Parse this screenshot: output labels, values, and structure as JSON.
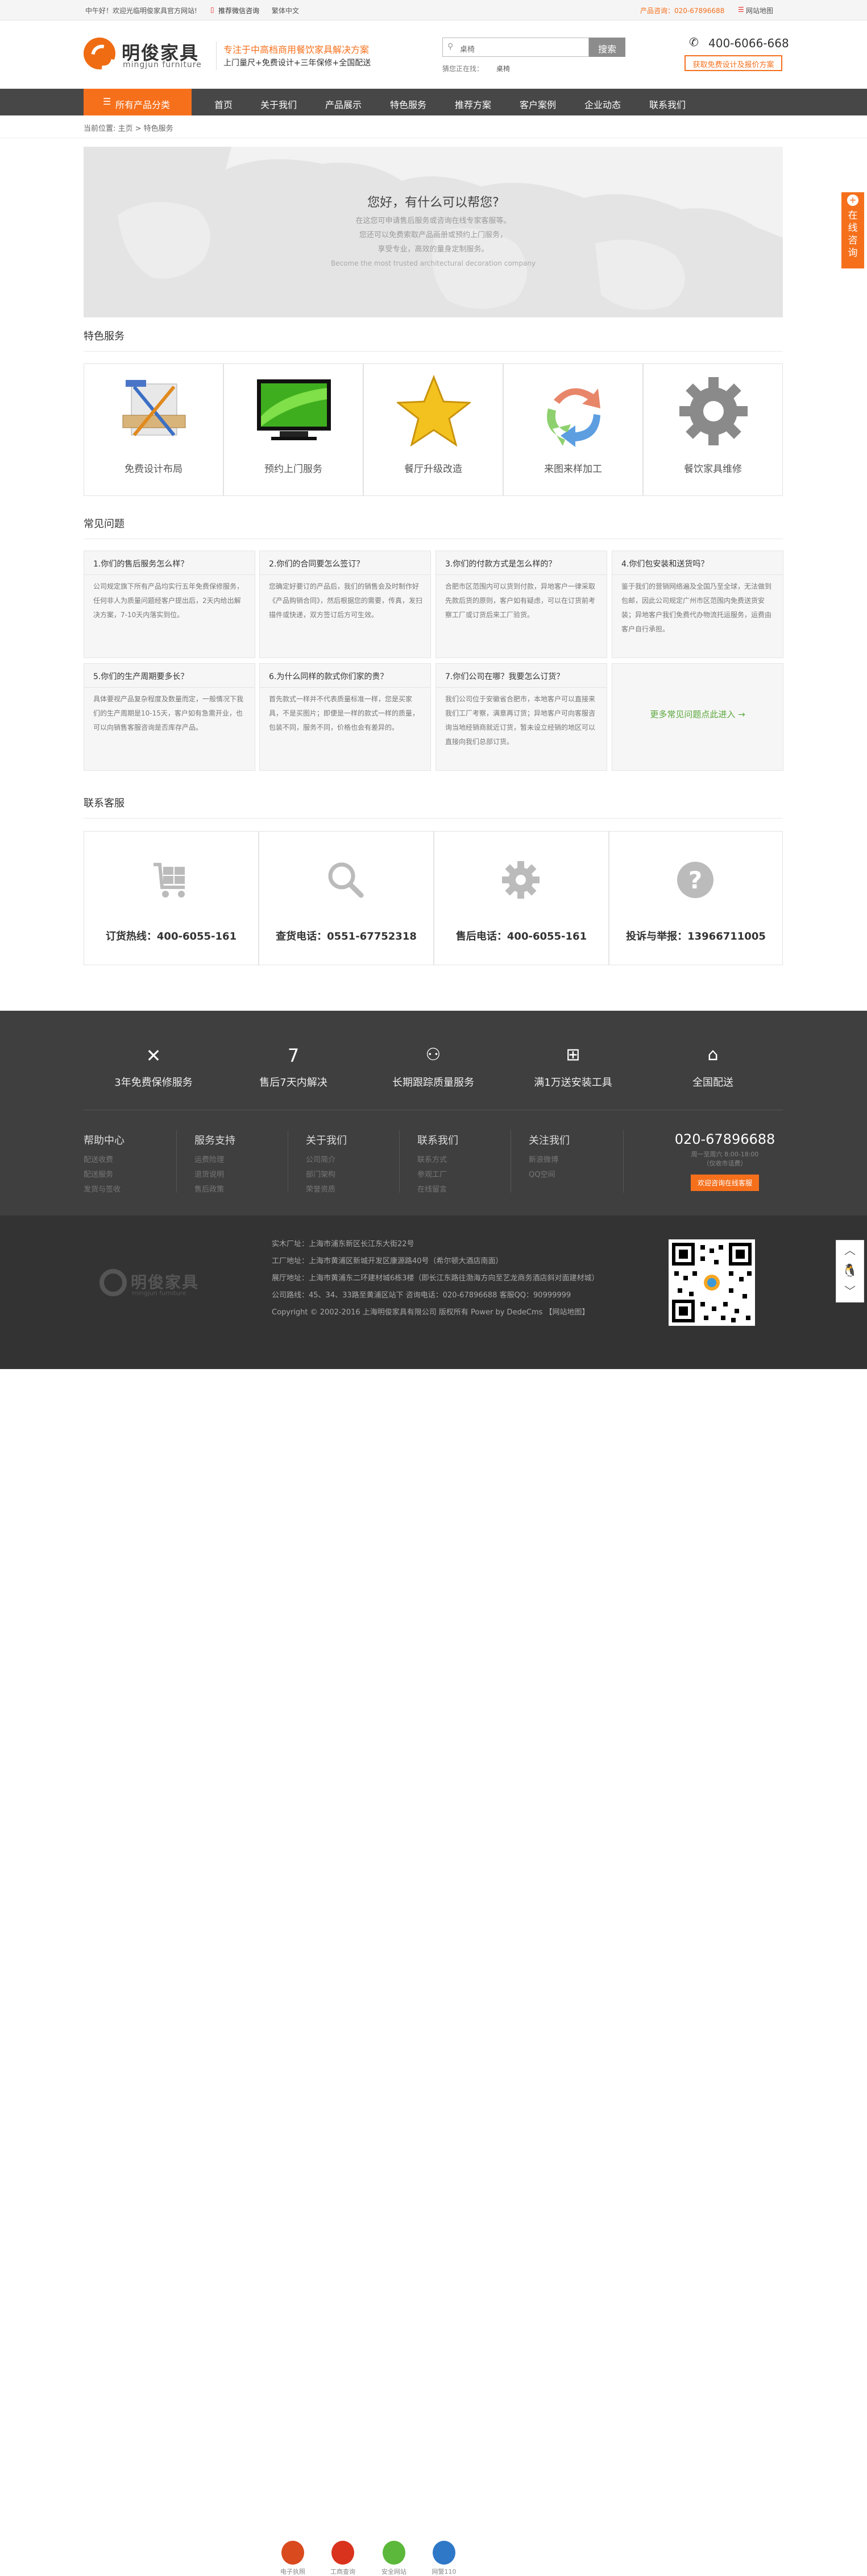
{
  "topbar": {
    "welcome": "中午好！欢迎光临明俊家具官方网站!",
    "wechat": "推荐微信咨询",
    "traditional": "繁体中文",
    "product_phone": "产品咨询：020-67896688",
    "sitemap": "网站地图"
  },
  "header": {
    "logo_cn": "明俊家具",
    "logo_en": "mingjun furniture",
    "slogan_main": "专注于中高档商用餐饮家具解决方案",
    "slogan_sub": "上门量尺+免费设计+三年保修+全国配送",
    "search_value": "桌椅",
    "search_button": "搜索",
    "search_hint_label": "猜您正在找：",
    "search_hint_value": "桌椅",
    "phone": "400-6066-668",
    "quote_button": "获取免费设计及报价方案"
  },
  "nav": {
    "category": "所有产品分类",
    "items": [
      "首页",
      "关于我们",
      "产品展示",
      "特色服务",
      "推荐方案",
      "客户案例",
      "企业动态",
      "联系我们"
    ]
  },
  "breadcrumb": "当前位置: 主页 > 特色服务",
  "banner": {
    "title": "您好，有什么可以帮您?",
    "lines": [
      "在这您可申请售后服务或咨询在线专家客服等。",
      "您还可以免费索取产品画册或预约上门服务，",
      "享受专业，高效的量身定制服务。"
    ],
    "en": "Become the most trusted architectural decoration company"
  },
  "features": {
    "title": "特色服务",
    "items": [
      {
        "label": "免费设计布局",
        "icon": "design-tools-icon"
      },
      {
        "label": "预约上门服务",
        "icon": "monitor-icon"
      },
      {
        "label": "餐厅升级改造",
        "icon": "star-icon"
      },
      {
        "label": "来图来样加工",
        "icon": "recycle-arrows-icon"
      },
      {
        "label": "餐饮家具维修",
        "icon": "gear-icon"
      }
    ]
  },
  "faq": {
    "title": "常见问题",
    "items": [
      {
        "q": "1.你们的售后服务怎么样？",
        "a": "公司规定旗下所有产品均实行五年免费保修服务，任何非人为质量问题经客户提出后，2天内给出解决方案，7-10天内落实到位。"
      },
      {
        "q": "2.你们的合同要怎么签订？",
        "a": "您确定好要订的产品后，我们的销售会及时制作好《产品购销合同》，然后根据您的需要，传真，发扫描件或快递，双方签订后方可生效。"
      },
      {
        "q": "3.你们的付款方式是怎么样的？",
        "a": "合肥市区范围内可以货到付款，异地客户一律采取先款后货的原则，客户如有疑虑，可以在订货前考察工厂或订货后来工厂验货。"
      },
      {
        "q": "4.你们包安装和送货吗？",
        "a": "鉴于我们的营销网络遍及全国乃至全球，无法做到包邮，因此公司规定广州市区范围内免费送货安装；异地客户我们免费代办物流托运服务，运费由客户自行承担。"
      },
      {
        "q": "5.你们的生产周期要多长？",
        "a": "具体要视产品复杂程度及数量而定，一般情况下我们的生产周期是10-15天，客户如有急需开业，也可以向销售客服咨询是否库存产品。"
      },
      {
        "q": "6.为什么同样的款式你们家的贵？",
        "a": "首先款式一样并不代表质量标准一样，您是买家具，不是买图片；即便是一样的款式一样的质量，包装不同，服务不同，价格也会有差异的。"
      },
      {
        "q": "7.你们公司在哪？我要怎么订货？",
        "a": "我们公司位于安徽省合肥市，本地客户可以直接来我们工厂考察，满意再订货；异地客户可向客服咨询当地经销商就近订货，暂未设立经销的地区可以直接向我们总部订货。"
      }
    ],
    "more": "更多常见问题点此进入 →"
  },
  "contact": {
    "title": "联系客服",
    "items": [
      {
        "label": "订货热线：400-6055-161",
        "icon": "cart-icon"
      },
      {
        "label": "查货电话：0551-67752318",
        "icon": "search-icon"
      },
      {
        "label": "售后电话：400-6055-161",
        "icon": "gear-icon"
      },
      {
        "label": "投诉与举报：13966711005",
        "icon": "question-icon"
      }
    ]
  },
  "services": [
    {
      "label": "3年免费保修服务",
      "icon": "tools-icon"
    },
    {
      "label": "售后7天内解决",
      "icon": "seven-icon"
    },
    {
      "label": "长期跟踪质量服务",
      "icon": "user-service-icon"
    },
    {
      "label": "满1万送安装工具",
      "icon": "gift-icon"
    },
    {
      "label": "全国配送",
      "icon": "map-icon"
    }
  ],
  "footer_cols": [
    {
      "title": "帮助中心",
      "links": [
        "配送收费",
        "配送服务",
        "发货与签收"
      ]
    },
    {
      "title": "服务支持",
      "links": [
        "运费险理",
        "退货说明",
        "售后政策"
      ]
    },
    {
      "title": "关于我们",
      "links": [
        "公司简介",
        "部门架构",
        "荣誉资质"
      ]
    },
    {
      "title": "联系我们",
      "links": [
        "联系方式",
        "参观工厂",
        "在线留言"
      ]
    },
    {
      "title": "关注我们",
      "links": [
        "新浪微博",
        "QQ空间"
      ]
    }
  ],
  "footer_phone": {
    "number": "020-67896688",
    "hours": "周一至周六 8:00-18:00",
    "note": "（仅收市话费）",
    "button": "欢迎咨询在线客服"
  },
  "footer_info": {
    "lines": [
      "实木厂址：上海市浦东新区长江东大街22号",
      "工厂地址：上海市黄浦区新城开发区康源路40号（希尔顿大酒店南面）",
      "展厅地址：上海市黄浦东二环建材城6栋3楼（即长江东路往渤海方向至艺龙商务酒店斜对面建材城）",
      "公司路线：45、34、33路至黄浦区站下    咨询电话：020-67896688    客服QQ：90999999",
      "Copyright © 2002-2016 上海明俊家具有限公司 版权所有 Power by DedeCms    【网站地图】"
    ],
    "badges": [
      "电子执照",
      "工商查询",
      "安全网站",
      "网警110"
    ]
  },
  "side": {
    "label": "在线咨询"
  },
  "colors": {
    "accent": "#f6701c",
    "nav": "#474747",
    "footer": "#3f3f3f",
    "green_link": "#5aa83a"
  }
}
